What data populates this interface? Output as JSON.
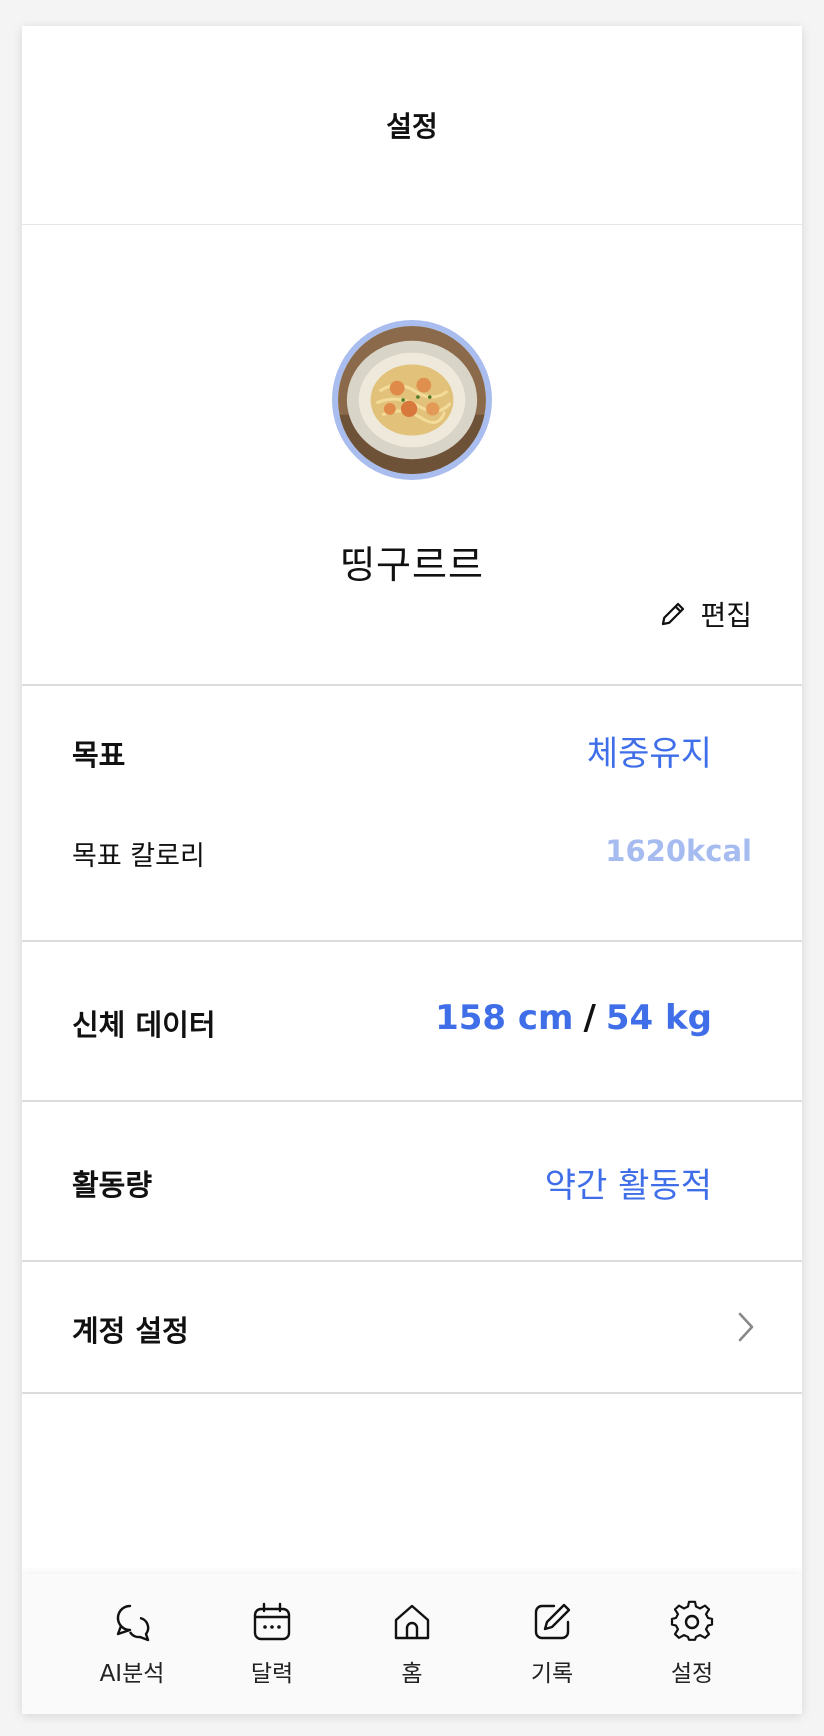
{
  "header": {
    "title": "설정"
  },
  "profile": {
    "nickname": "띵구르르",
    "avatar_icon": "food-photo-avatar",
    "edit_label": "편집"
  },
  "goal": {
    "label": "목표",
    "value": "체중유지",
    "calorie_label": "목표 칼로리",
    "calorie_value": "1620kcal"
  },
  "body_data": {
    "label": "신체 데이터",
    "height": "158 cm",
    "separator": "/",
    "weight": "54 kg"
  },
  "activity": {
    "label": "활동량",
    "value": "약간 활동적"
  },
  "account": {
    "label": "계정 설정"
  },
  "nav": {
    "items": [
      {
        "label": "AI분석",
        "icon": "chat-bubbles-icon"
      },
      {
        "label": "달력",
        "icon": "calendar-icon"
      },
      {
        "label": "홈",
        "icon": "home-icon"
      },
      {
        "label": "기록",
        "icon": "edit-note-icon"
      },
      {
        "label": "설정",
        "icon": "gear-icon"
      }
    ]
  },
  "colors": {
    "accent": "#3f6ee8",
    "accent_light": "#a6bcf0",
    "avatar_ring": "#a9bdee"
  }
}
